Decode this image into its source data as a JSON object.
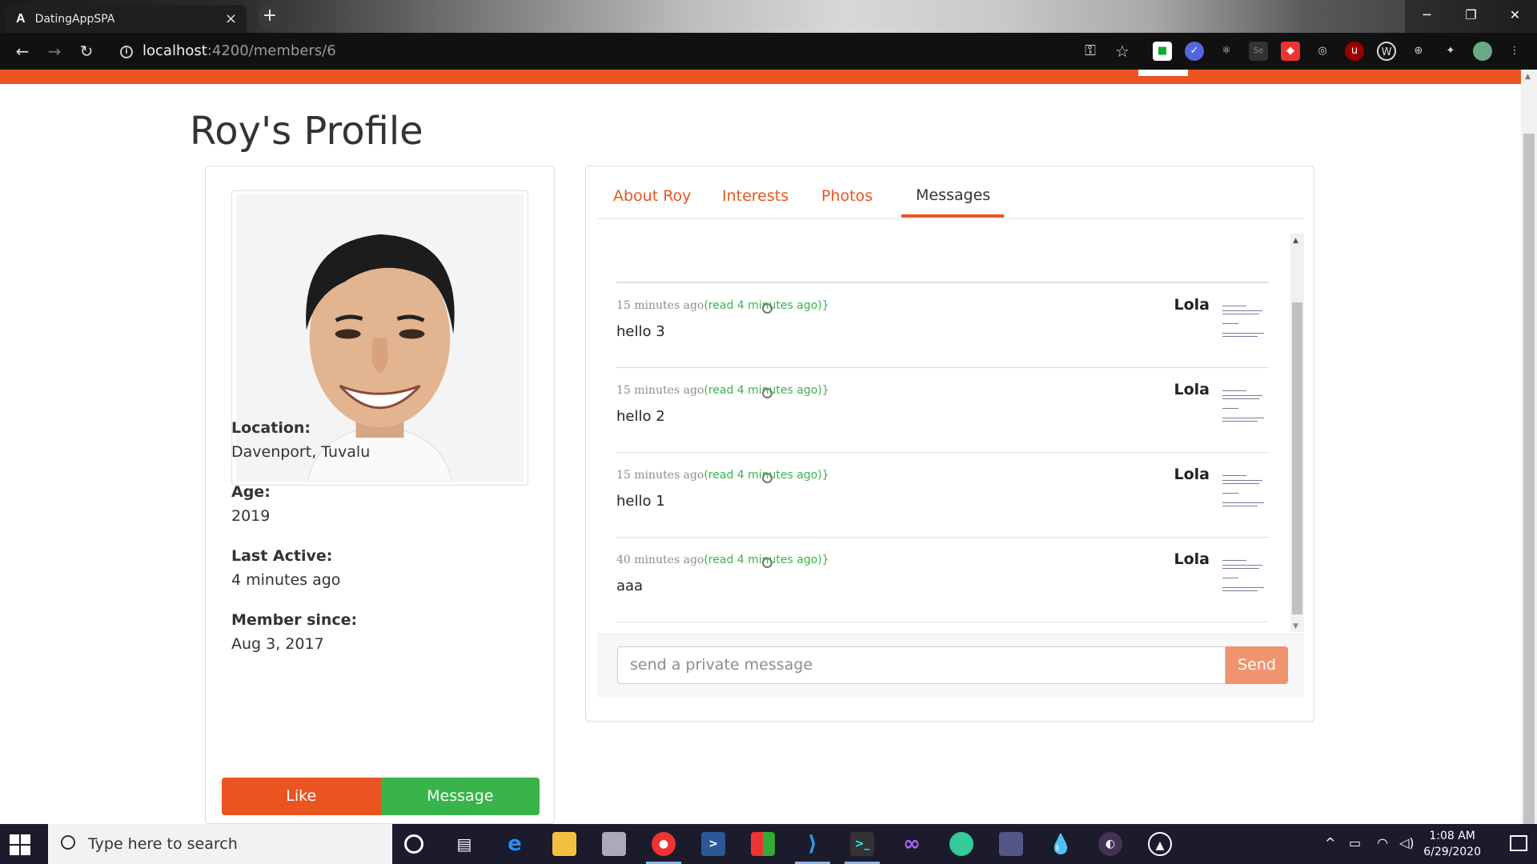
{
  "browser": {
    "tab_title": "DatingAppSPA",
    "tab_favicon": "A",
    "tab_close": "×",
    "new_tab": "+",
    "url_host": "localhost",
    "url_path": ":4200/members/6",
    "window_controls": [
      "─",
      "❐",
      "✕"
    ]
  },
  "page": {
    "title": "Roy's Profile"
  },
  "profile": {
    "location_label": "Location:",
    "location_value": "Davenport, Tuvalu",
    "age_label": "Age:",
    "age_value": "2019",
    "last_active_label": "Last Active:",
    "last_active_value": "4 minutes ago",
    "member_since_label": "Member since:",
    "member_since_value": "Aug 3, 2017",
    "like_button": "Like",
    "message_button": "Message"
  },
  "tabs": [
    {
      "label": "About Roy",
      "active": false
    },
    {
      "label": "Interests",
      "active": false
    },
    {
      "label": "Photos",
      "active": false
    },
    {
      "label": "Messages",
      "active": true
    }
  ],
  "messages": [
    {
      "time": "15 minutes ago",
      "read": "(read 4 minutes ago)}",
      "content": "hello 3",
      "sender": "Lola"
    },
    {
      "time": "15 minutes ago",
      "read": "(read 4 minutes ago)}",
      "content": "hello 2",
      "sender": "Lola"
    },
    {
      "time": "15 minutes ago",
      "read": "(read 4 minutes ago)}",
      "content": "hello 1",
      "sender": "Lola"
    },
    {
      "time": "40 minutes ago",
      "read": "(read 4 minutes ago)}",
      "content": "aaa",
      "sender": "Lola"
    }
  ],
  "composer": {
    "placeholder": "send a private message",
    "send_button": "Send"
  },
  "taskbar": {
    "search_placeholder": "Type here to search",
    "time": "1:08 AM",
    "date": "6/29/2020"
  },
  "colors": {
    "brand": "#e95420",
    "success": "#38b44a",
    "send_disabled": "#f0936f"
  }
}
